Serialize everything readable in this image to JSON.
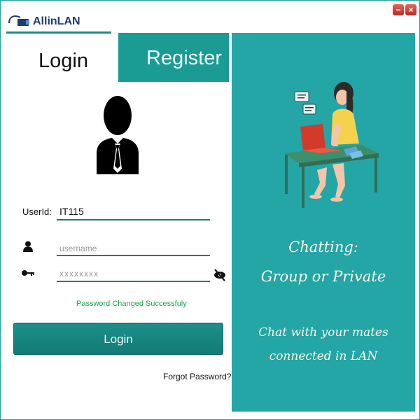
{
  "app": {
    "brand": "AllinLAN"
  },
  "window": {
    "minimize": "−",
    "close": "×"
  },
  "tabs": {
    "login": "Login",
    "register": "Register"
  },
  "form": {
    "userid_label": "UserId:",
    "userid_value": "IT115",
    "username_placeholder": "username",
    "password_placeholder": "xxxxxxxx",
    "status_message": "Password Changed Successfuly",
    "login_button": "Login",
    "forgot_link": "Forgot Password?"
  },
  "promo": {
    "line1": "Chatting:",
    "line2": "Group or Private",
    "line3": "Chat with your mates",
    "line4": "connected in LAN"
  },
  "colors": {
    "accent": "#1a9c95",
    "panel": "#24a5a6",
    "success": "#1aa64a"
  }
}
